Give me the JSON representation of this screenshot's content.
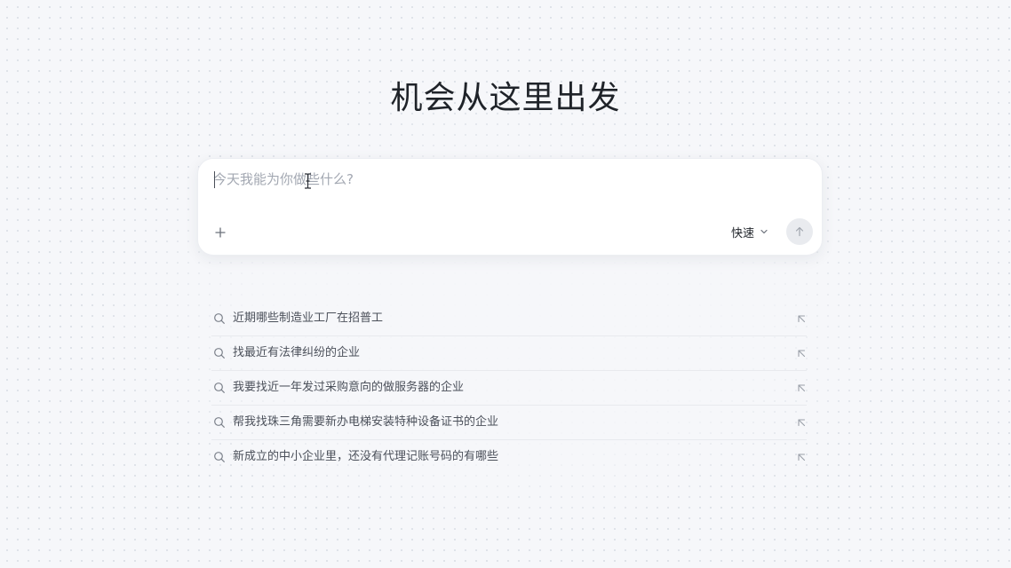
{
  "hero": {
    "title": "机会从这里出发"
  },
  "composer": {
    "placeholder": "今天我能为你做些什么?",
    "value": "",
    "add_icon": "plus-icon",
    "mode_label": "快速",
    "mode_icon": "chevron-down-icon",
    "send_icon": "arrow-up-icon"
  },
  "suggestions": {
    "items": [
      {
        "text": "近期哪些制造业工厂在招普工",
        "icon": "search-icon",
        "action_icon": "arrow-up-left-icon"
      },
      {
        "text": "找最近有法律纠纷的企业",
        "icon": "search-icon",
        "action_icon": "arrow-up-left-icon"
      },
      {
        "text": "我要找近一年发过采购意向的做服务器的企业",
        "icon": "search-icon",
        "action_icon": "arrow-up-left-icon"
      },
      {
        "text": "帮我找珠三角需要新办电梯安装特种设备证书的企业",
        "icon": "search-icon",
        "action_icon": "arrow-up-left-icon"
      },
      {
        "text": "新成立的中小企业里，还没有代理记账号码的有哪些",
        "icon": "search-icon",
        "action_icon": "arrow-up-left-icon"
      }
    ]
  },
  "colors": {
    "background": "#f6f7fa",
    "title": "#1f2329",
    "placeholder": "#a3a8b2",
    "send_button": "#e9ebef",
    "suggestion_text": "#4b505a"
  }
}
